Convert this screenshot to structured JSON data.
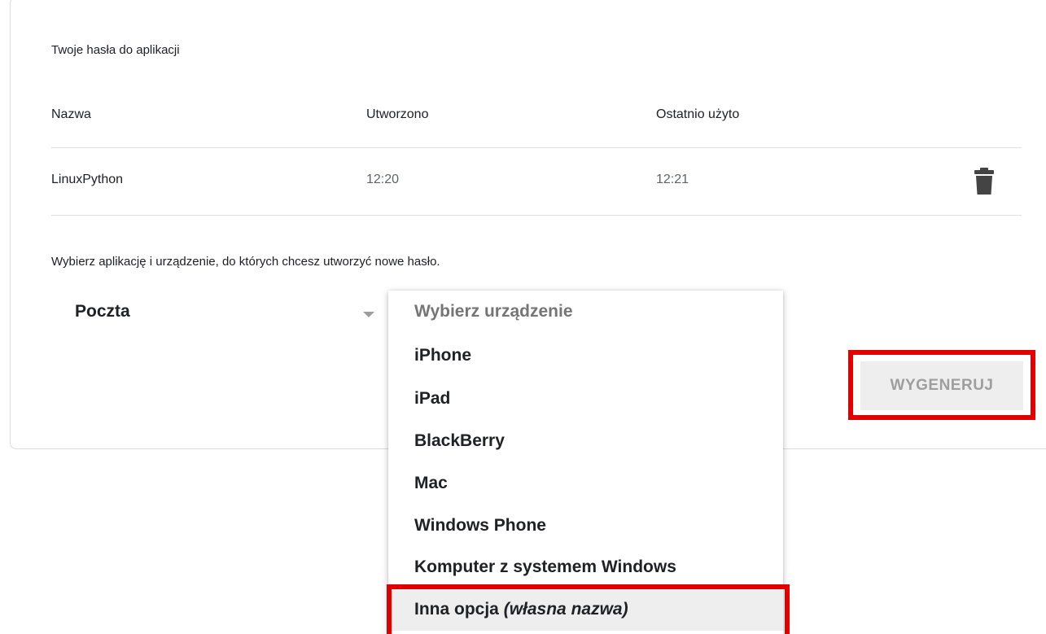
{
  "section_title": "Twoje hasła do aplikacji",
  "table": {
    "columns": [
      "Nazwa",
      "Utworzono",
      "Ostatnio użyto"
    ],
    "rows": [
      {
        "name": "LinuxPython",
        "created": "12:20",
        "last_used": "12:21"
      }
    ],
    "delete_icon": "trash-icon"
  },
  "instructions": "Wybierz aplikację i urządzenie, do których chcesz utworzyć nowe hasło.",
  "app_select": {
    "value": "Poczta"
  },
  "device_menu": {
    "placeholder": "Wybierz urządzenie",
    "items": [
      "iPhone",
      "iPad",
      "BlackBerry",
      "Mac",
      "Windows Phone",
      "Komputer z systemem Windows"
    ],
    "other_option": {
      "label": "Inna opcja",
      "label_italic": "(własna nazwa)"
    }
  },
  "generate_button": {
    "label": "WYGENERUJ"
  },
  "colors": {
    "highlight": "#e00000",
    "button_bg": "#eeeeee",
    "button_text": "#9e9e9e"
  }
}
